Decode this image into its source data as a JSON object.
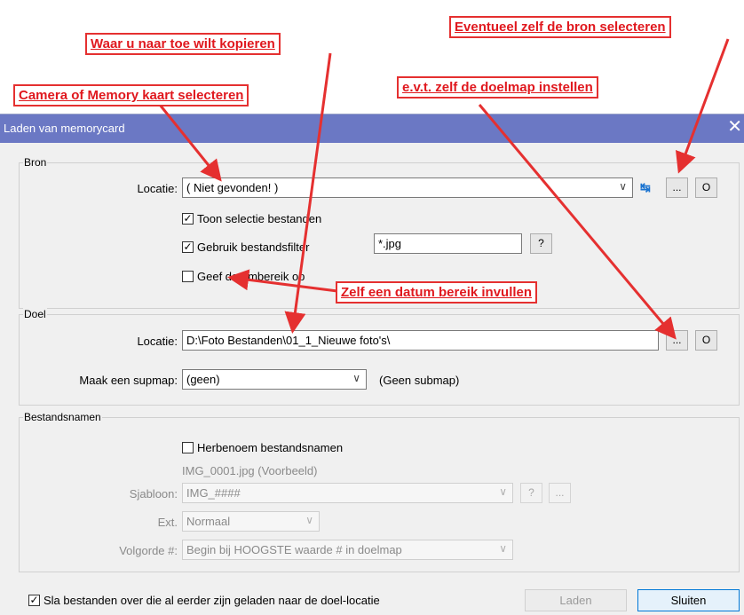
{
  "dialog": {
    "title": "Laden van memorycard",
    "close_label": "✕"
  },
  "bron": {
    "group_label": "Bron",
    "locatie_label": "Locatie:",
    "locatie_value": "( Niet gevonden! )",
    "refresh_glyph": "↹",
    "browse_label": "...",
    "o_label": "O",
    "toon_selectie_label": "Toon selectie bestanden",
    "toon_selectie_checked": "✓",
    "gebruik_filter_label": "Gebruik bestandsfilter",
    "gebruik_filter_checked": "✓",
    "filter_value": "*.jpg",
    "filter_help_label": "?",
    "datum_label": "Geef datumbereik op"
  },
  "doel": {
    "group_label": "Doel",
    "locatie_label": "Locatie:",
    "locatie_value": "D:\\Foto Bestanden\\01_1_Nieuwe foto's\\",
    "browse_label": "...",
    "o_label": "O",
    "submap_label": "Maak een supmap:",
    "submap_value": "(geen)",
    "submap_hint": "(Geen submap)"
  },
  "bestandsnamen": {
    "group_label": "Bestandsnamen",
    "herbenoem_label": "Herbenoem bestandsnamen",
    "example_text": "IMG_0001.jpg  (Voorbeeld)",
    "sjabloon_label": "Sjabloon:",
    "sjabloon_value": "IMG_####",
    "help_label": "?",
    "dots_label": "...",
    "ext_label": "Ext.",
    "ext_value": "Normaal",
    "volgorde_label": "Volgorde #:",
    "volgorde_value": "Begin bij HOOGSTE waarde # in doelmap"
  },
  "footer": {
    "skip_label": "Sla bestanden over die al eerder zijn geladen naar de doel-locatie",
    "skip_checked": "✓",
    "laden_label": "Laden",
    "sluiten_label": "Sluiten"
  },
  "annotations": {
    "kopieren": "Waar u naar toe wilt kopieren",
    "bron_selecteren": "Eventueel zelf de bron selecteren",
    "camera": "Camera of Memory kaart selecteren",
    "doelmap": "e.v.t. zelf de doelmap instellen",
    "datum": "Zelf een datum bereik invullen"
  },
  "colors": {
    "titlebar": "#6b78c4",
    "annotation": "#e0181e"
  }
}
